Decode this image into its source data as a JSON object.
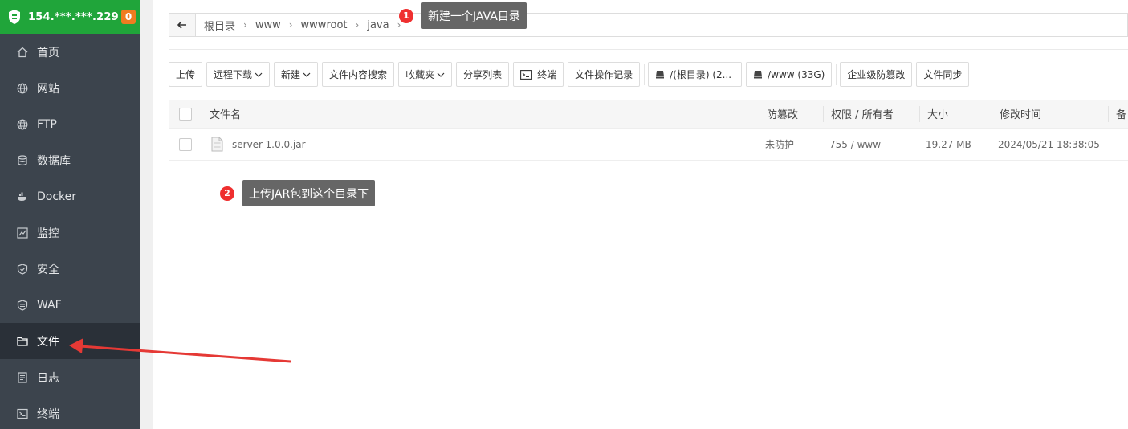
{
  "sidebar": {
    "server_ip": "154.***.***.229",
    "badge_count": "0",
    "items": [
      {
        "label": "首页",
        "icon": "home-icon"
      },
      {
        "label": "网站",
        "icon": "globe-icon"
      },
      {
        "label": "FTP",
        "icon": "ftp-icon"
      },
      {
        "label": "数据库",
        "icon": "database-icon"
      },
      {
        "label": "Docker",
        "icon": "docker-icon"
      },
      {
        "label": "监控",
        "icon": "monitor-icon"
      },
      {
        "label": "安全",
        "icon": "shield-icon"
      },
      {
        "label": "WAF",
        "icon": "waf-icon"
      },
      {
        "label": "文件",
        "icon": "folder-icon",
        "active": true
      },
      {
        "label": "日志",
        "icon": "log-icon"
      },
      {
        "label": "终端",
        "icon": "terminal-icon"
      }
    ]
  },
  "breadcrumb": [
    "根目录",
    "www",
    "wwwroot",
    "java"
  ],
  "toolbar": {
    "upload": "上传",
    "remote_download": "远程下载",
    "new": "新建",
    "content_search": "文件内容搜索",
    "favorites": "收藏夹",
    "share_list": "分享列表",
    "terminal": "终端",
    "op_log": "文件操作记录",
    "disk_root": "/(根目录) (2...",
    "disk_www": "/www (33G)",
    "tamper_proof": "企业级防篡改",
    "file_sync": "文件同步"
  },
  "table": {
    "headers": {
      "name": "文件名",
      "protect": "防篡改",
      "perm": "权限 / 所有者",
      "size": "大小",
      "mtime": "修改时间",
      "remark": "备"
    },
    "rows": [
      {
        "name": "server-1.0.0.jar",
        "protect": "未防护",
        "perm": "755 / www",
        "size": "19.27 MB",
        "mtime": "2024/05/21 18:38:05"
      }
    ]
  },
  "annotations": [
    {
      "num": "1",
      "text": "新建一个JAVA目录"
    },
    {
      "num": "2",
      "text": "上传JAR包到这个目录下"
    }
  ],
  "colors": {
    "sidebar_bg": "#3c444d",
    "sidebar_header": "#20a53a",
    "badge": "#ef7c20",
    "annotation_red": "#ef2f2f",
    "tip_bg": "#666666"
  }
}
